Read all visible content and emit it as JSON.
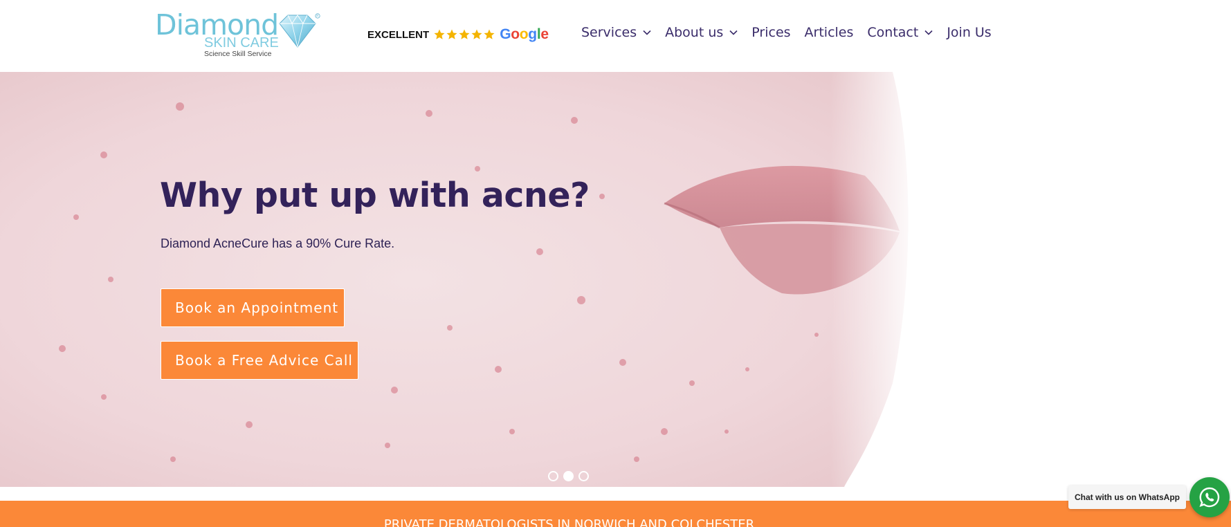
{
  "header": {
    "logo": {
      "wordmark": "Diamond",
      "subtitle": "SKIN CARE",
      "tagline": "Science Skill Service"
    },
    "rating": {
      "label": "EXCELLENT",
      "stars": 5,
      "provider_icon": "google-logo",
      "provider_letters": [
        "G",
        "o",
        "o",
        "g",
        "l",
        "e"
      ]
    },
    "nav": [
      {
        "label": "Services",
        "has_dropdown": true
      },
      {
        "label": "About us",
        "has_dropdown": true
      },
      {
        "label": "Prices",
        "has_dropdown": false
      },
      {
        "label": "Articles",
        "has_dropdown": false
      },
      {
        "label": "Contact",
        "has_dropdown": true
      },
      {
        "label": "Join Us",
        "has_dropdown": false
      }
    ]
  },
  "hero": {
    "title": "Why put up with acne?",
    "subtitle": "Diamond AcneCure has a 90% Cure Rate.",
    "buttons": {
      "appointment": "Book an Appointment",
      "advice_call": "Book a Free Advice Call"
    },
    "slider": {
      "count": 3,
      "active_index": 2
    }
  },
  "strip": {
    "text": "PRIVATE DERMATOLOGISTS IN NORWICH AND COLCHESTER"
  },
  "whatsapp": {
    "label": "Chat with us on WhatsApp",
    "icon": "whatsapp-icon"
  },
  "colors": {
    "accent": "#fb8838",
    "heading": "#33225a",
    "nav_text": "#3a2c6a",
    "logo_blue": "#6ec3d9",
    "whatsapp_green": "#25a244",
    "star_gold": "#f4b400"
  }
}
